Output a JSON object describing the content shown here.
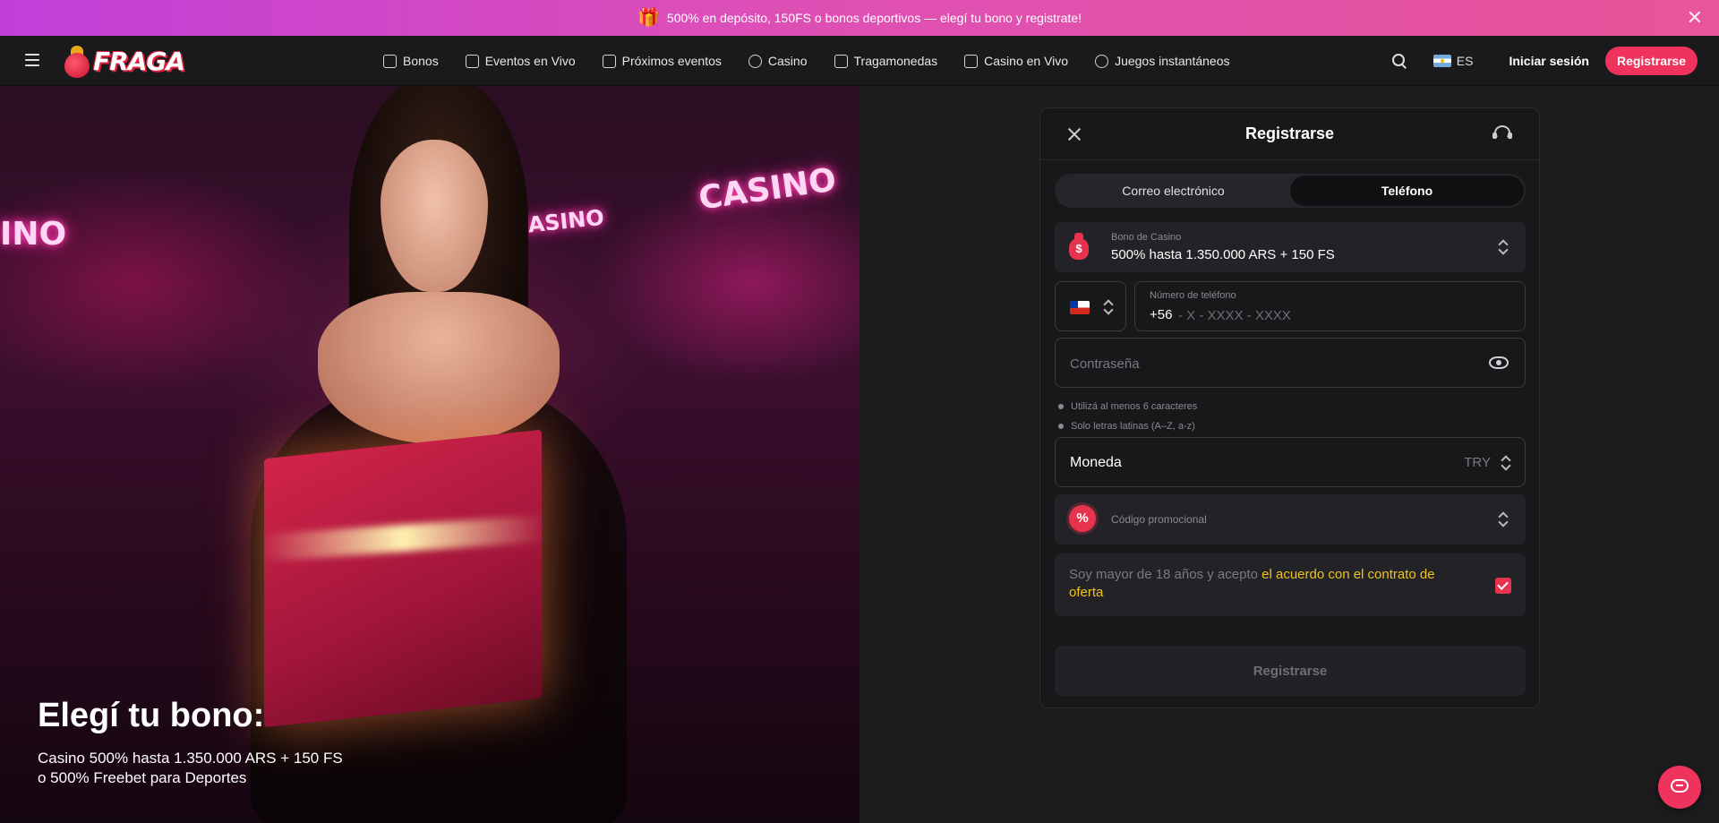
{
  "promo_banner": {
    "text": "500% en depósito, 150FS o bonos deportivos — elegí tu bono y registrate!",
    "gift_icon": "gift-icon",
    "close_icon": "close-icon"
  },
  "header": {
    "logo_text": "FRAGA",
    "nav": [
      {
        "label": "Bonos",
        "icon": "gift-icon"
      },
      {
        "label": "Eventos en Vivo",
        "icon": "live-events-icon"
      },
      {
        "label": "Próximos eventos",
        "icon": "calendar-icon"
      },
      {
        "label": "Casino",
        "icon": "chip-icon"
      },
      {
        "label": "Tragamonedas",
        "icon": "slots-icon"
      },
      {
        "label": "Casino en Vivo",
        "icon": "cards-icon"
      },
      {
        "label": "Juegos instantáneos",
        "icon": "rocket-icon"
      }
    ],
    "language": "ES",
    "login_label": "Iniciar sesión",
    "register_label": "Registrarse"
  },
  "hero": {
    "title": "Elegí tu bono:",
    "subtitle_line1": "Casino 500% hasta 1.350.000 ARS + 150 FS",
    "subtitle_line2": "o 500% Freebet para Deportes",
    "neon_sign_1": "CASINO",
    "neon_sign_2": "CASINO",
    "neon_sign_3": "INO"
  },
  "modal": {
    "title": "Registrarse",
    "tabs": [
      {
        "label": "Correo electrónico",
        "active": false
      },
      {
        "label": "Teléfono",
        "active": true
      }
    ],
    "bonus": {
      "label": "Bono de Casino",
      "value": "500% hasta 1.350.000 ARS + 150 FS",
      "icon_symbol": "$"
    },
    "phone": {
      "label": "Número de teléfono",
      "code": "+56",
      "placeholder": "- X - XXXX - XXXX",
      "value": ""
    },
    "password": {
      "placeholder": "Contraseña",
      "value": ""
    },
    "hints": [
      "Utilizá al menos 6 caracteres",
      "Solo letras latinas (A–Z, a-z)"
    ],
    "currency": {
      "label": "Moneda",
      "value": "TRY"
    },
    "promo_code": {
      "label": "Código promocional",
      "icon_symbol": "%"
    },
    "agreement": {
      "text": "Soy mayor de 18 años y acepto ",
      "link": "el acuerdo con el contrato de oferta",
      "checked": true
    },
    "submit_label": "Registrarse"
  },
  "colors": {
    "accent": "#f0335c",
    "link": "#f0c319",
    "background": "#1c1c1f",
    "panel": "#18181b"
  }
}
